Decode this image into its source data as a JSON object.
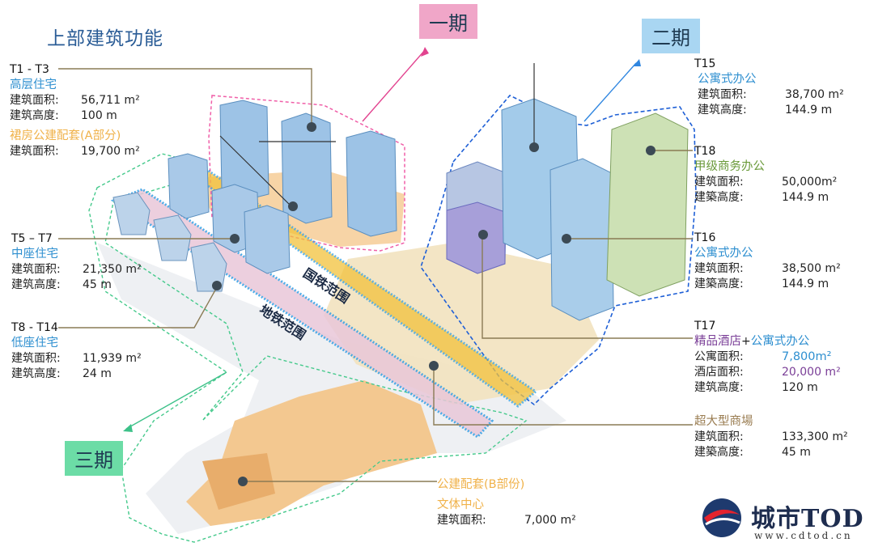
{
  "title": "上部建筑功能",
  "phases": {
    "p1": "一期",
    "p2": "二期",
    "p3": "三期"
  },
  "bands": {
    "rail": "国铁范围",
    "metro": "地铁范围"
  },
  "t1_t3": {
    "code": "T1 - T3",
    "type": "高层住宅",
    "k1": "建筑面积:",
    "v1": "56,711 m²",
    "k2": "建筑高度:",
    "v2": "100 m",
    "sub": "裙房公建配套(A部分)",
    "k3": "建筑面积:",
    "v3": "19,700 m²"
  },
  "t5_t7": {
    "code": "T5 – T7",
    "type": "中座住宅",
    "k1": "建筑面积:",
    "v1": "21,350 m²",
    "k2": "建筑高度:",
    "v2": "45 m"
  },
  "t8_t14": {
    "code": "T8 - T14",
    "type": "低座住宅",
    "k1": "建筑面积:",
    "v1": "11,939 m²",
    "k2": "建筑高度:",
    "v2": "24 m"
  },
  "t15": {
    "code": "T15",
    "type": "公寓式办公",
    "k1": "建筑面积:",
    "v1": "38,700 m²",
    "k2": "建筑高度:",
    "v2": "144.9 m"
  },
  "t18": {
    "code": "T18",
    "type": "甲级商务办公",
    "k1": "建筑面积:",
    "v1": "50,000m²",
    "k2": "建築高度:",
    "v2": "144.9 m"
  },
  "t16": {
    "code": "T16",
    "type": "公寓式办公",
    "k1": "建筑面积:",
    "v1": "38,500 m²",
    "k2": "建築高度:",
    "v2": "144.9 m"
  },
  "t17": {
    "code": "T17",
    "type_a": "精品酒店",
    "plus": "+",
    "type_b": "公寓式办公",
    "k1": "公寓面积:",
    "v1": "7,800m²",
    "k2": "酒店面积:",
    "v2": "20,000 m²",
    "k3": "建筑高度:",
    "v3": "120 m"
  },
  "mall": {
    "type": "超大型商場",
    "k1": "建筑面积:",
    "v1": "133,300 m²",
    "k2": "建築高度:",
    "v2": "45 m"
  },
  "public_b": {
    "type": "公建配套(B部份)",
    "sub": "文体中心",
    "k1": "建筑面积:",
    "v1": "7,000 m²"
  },
  "logo": {
    "name": "城市TOD",
    "url": "www.cdtod.cn"
  },
  "colors": {
    "title": "#2a5c96",
    "phase1": "#f0a6c8",
    "phase2": "#a9d6f2",
    "phase3": "#6cdca6",
    "rail_band": "#f2c23c",
    "metro_band": "#e9c7d9",
    "dotted_blue": "#2fa0e6"
  }
}
